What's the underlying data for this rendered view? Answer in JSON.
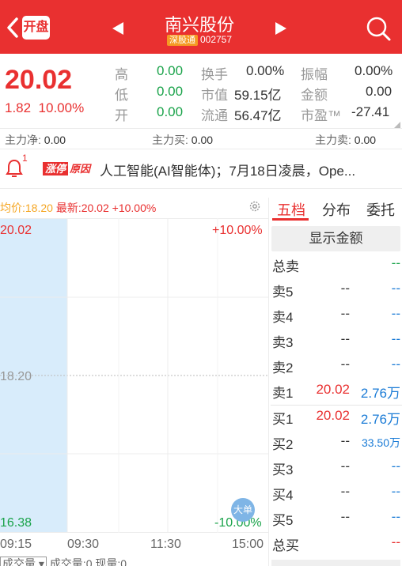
{
  "header": {
    "open_label": "开盘",
    "stock_name": "南兴股份",
    "badge": "深股通",
    "code": "002757"
  },
  "quote": {
    "price": "20.02",
    "change": "1.82",
    "change_pct": "10.00%",
    "rows": [
      {
        "label1": "高",
        "val1": "0.00",
        "label2": "换手",
        "val2": "0.00%",
        "label3": "振幅",
        "val3": "0.00%"
      },
      {
        "label1": "低",
        "val1": "0.00",
        "label2": "市值",
        "val2": "59.15亿",
        "label3": "金额",
        "val3": "0.00"
      },
      {
        "label1": "开",
        "val1": "0.00",
        "label2": "流通",
        "val2": "56.47亿",
        "label3": "市盈™",
        "val3": "-27.41"
      }
    ]
  },
  "mainforce": {
    "net_label": "主力净:",
    "net_value": "0.00",
    "buy_label": "主力买:",
    "buy_value": "0.00",
    "sell_label": "主力卖:",
    "sell_value": "0.00"
  },
  "news": {
    "count": "1",
    "tag_part1": "涨停",
    "tag_part2": "原因",
    "text": "人工智能(AI智能体)；7月18日凌晨，Ope..."
  },
  "chart": {
    "avg_label": "均价:18.20",
    "latest_label": "最新:20.02",
    "latest_pct": "+10.00%",
    "price_max": "20.02",
    "price_mid": "18.20",
    "price_min": "16.38",
    "pct_max": "+10.00%",
    "pct_min": "-10.00%",
    "bubble": "大单",
    "times": [
      "09:15",
      "09:30",
      "11:30",
      "15:00"
    ],
    "vol_selector": "成交量 ▾",
    "vol_text": "成交量:0 现量:0"
  },
  "panel": {
    "tabs": [
      "五档",
      "分布",
      "委托"
    ],
    "show_amount": "显示金额",
    "total_sell_label": "总卖",
    "total_sell_value": "--",
    "sells": [
      {
        "label": "卖5",
        "price": "--",
        "vol": "--"
      },
      {
        "label": "卖4",
        "price": "--",
        "vol": "--"
      },
      {
        "label": "卖3",
        "price": "--",
        "vol": "--"
      },
      {
        "label": "卖2",
        "price": "--",
        "vol": "--"
      },
      {
        "label": "卖1",
        "price": "20.02",
        "vol": "2.76万"
      }
    ],
    "buys": [
      {
        "label": "买1",
        "price": "20.02",
        "vol": "2.76万"
      },
      {
        "label": "买2",
        "price": "--",
        "vol": "33.50万"
      },
      {
        "label": "买3",
        "price": "--",
        "vol": "--"
      },
      {
        "label": "买4",
        "price": "--",
        "vol": "--"
      },
      {
        "label": "买5",
        "price": "--",
        "vol": "--"
      }
    ],
    "total_buy_label": "总买",
    "total_buy_value": "--"
  },
  "colors": {
    "brand_red": "#e93030",
    "up_red": "#e93030",
    "down_green": "#1aa34a",
    "volume_blue": "#1a7bd6"
  }
}
